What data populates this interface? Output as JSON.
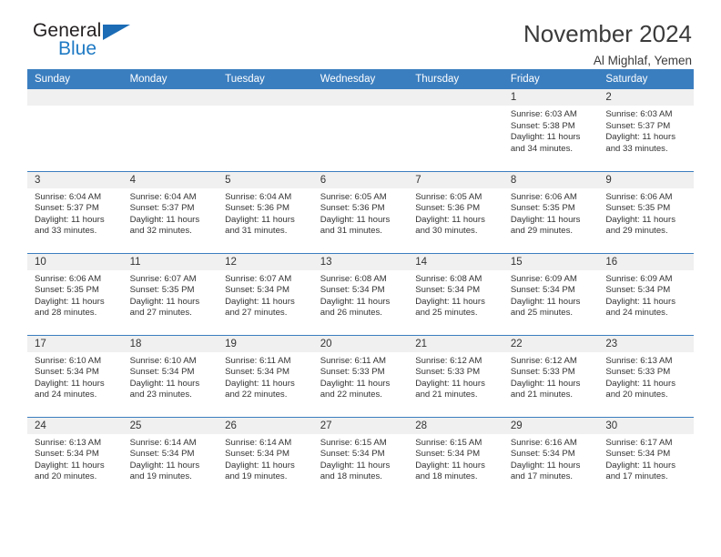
{
  "brand": {
    "word_general": "General",
    "word_blue": "Blue",
    "accent_color": "#1b6cb5"
  },
  "header": {
    "title": "November 2024",
    "subtitle": "Al Mighlaf, Yemen"
  },
  "theme": {
    "header_row_bg": "#3b7ebf",
    "daynum_bg": "#f0f0f0",
    "text_color": "#333333"
  },
  "weekday_headers": [
    "Sunday",
    "Monday",
    "Tuesday",
    "Wednesday",
    "Thursday",
    "Friday",
    "Saturday"
  ],
  "weeks": [
    [
      {
        "day": "",
        "empty": true
      },
      {
        "day": "",
        "empty": true
      },
      {
        "day": "",
        "empty": true
      },
      {
        "day": "",
        "empty": true
      },
      {
        "day": "",
        "empty": true
      },
      {
        "day": "1",
        "sunrise": "Sunrise: 6:03 AM",
        "sunset": "Sunset: 5:38 PM",
        "daylight1": "Daylight: 11 hours",
        "daylight2": "and 34 minutes."
      },
      {
        "day": "2",
        "sunrise": "Sunrise: 6:03 AM",
        "sunset": "Sunset: 5:37 PM",
        "daylight1": "Daylight: 11 hours",
        "daylight2": "and 33 minutes."
      }
    ],
    [
      {
        "day": "3",
        "sunrise": "Sunrise: 6:04 AM",
        "sunset": "Sunset: 5:37 PM",
        "daylight1": "Daylight: 11 hours",
        "daylight2": "and 33 minutes."
      },
      {
        "day": "4",
        "sunrise": "Sunrise: 6:04 AM",
        "sunset": "Sunset: 5:37 PM",
        "daylight1": "Daylight: 11 hours",
        "daylight2": "and 32 minutes."
      },
      {
        "day": "5",
        "sunrise": "Sunrise: 6:04 AM",
        "sunset": "Sunset: 5:36 PM",
        "daylight1": "Daylight: 11 hours",
        "daylight2": "and 31 minutes."
      },
      {
        "day": "6",
        "sunrise": "Sunrise: 6:05 AM",
        "sunset": "Sunset: 5:36 PM",
        "daylight1": "Daylight: 11 hours",
        "daylight2": "and 31 minutes."
      },
      {
        "day": "7",
        "sunrise": "Sunrise: 6:05 AM",
        "sunset": "Sunset: 5:36 PM",
        "daylight1": "Daylight: 11 hours",
        "daylight2": "and 30 minutes."
      },
      {
        "day": "8",
        "sunrise": "Sunrise: 6:06 AM",
        "sunset": "Sunset: 5:35 PM",
        "daylight1": "Daylight: 11 hours",
        "daylight2": "and 29 minutes."
      },
      {
        "day": "9",
        "sunrise": "Sunrise: 6:06 AM",
        "sunset": "Sunset: 5:35 PM",
        "daylight1": "Daylight: 11 hours",
        "daylight2": "and 29 minutes."
      }
    ],
    [
      {
        "day": "10",
        "sunrise": "Sunrise: 6:06 AM",
        "sunset": "Sunset: 5:35 PM",
        "daylight1": "Daylight: 11 hours",
        "daylight2": "and 28 minutes."
      },
      {
        "day": "11",
        "sunrise": "Sunrise: 6:07 AM",
        "sunset": "Sunset: 5:35 PM",
        "daylight1": "Daylight: 11 hours",
        "daylight2": "and 27 minutes."
      },
      {
        "day": "12",
        "sunrise": "Sunrise: 6:07 AM",
        "sunset": "Sunset: 5:34 PM",
        "daylight1": "Daylight: 11 hours",
        "daylight2": "and 27 minutes."
      },
      {
        "day": "13",
        "sunrise": "Sunrise: 6:08 AM",
        "sunset": "Sunset: 5:34 PM",
        "daylight1": "Daylight: 11 hours",
        "daylight2": "and 26 minutes."
      },
      {
        "day": "14",
        "sunrise": "Sunrise: 6:08 AM",
        "sunset": "Sunset: 5:34 PM",
        "daylight1": "Daylight: 11 hours",
        "daylight2": "and 25 minutes."
      },
      {
        "day": "15",
        "sunrise": "Sunrise: 6:09 AM",
        "sunset": "Sunset: 5:34 PM",
        "daylight1": "Daylight: 11 hours",
        "daylight2": "and 25 minutes."
      },
      {
        "day": "16",
        "sunrise": "Sunrise: 6:09 AM",
        "sunset": "Sunset: 5:34 PM",
        "daylight1": "Daylight: 11 hours",
        "daylight2": "and 24 minutes."
      }
    ],
    [
      {
        "day": "17",
        "sunrise": "Sunrise: 6:10 AM",
        "sunset": "Sunset: 5:34 PM",
        "daylight1": "Daylight: 11 hours",
        "daylight2": "and 24 minutes."
      },
      {
        "day": "18",
        "sunrise": "Sunrise: 6:10 AM",
        "sunset": "Sunset: 5:34 PM",
        "daylight1": "Daylight: 11 hours",
        "daylight2": "and 23 minutes."
      },
      {
        "day": "19",
        "sunrise": "Sunrise: 6:11 AM",
        "sunset": "Sunset: 5:34 PM",
        "daylight1": "Daylight: 11 hours",
        "daylight2": "and 22 minutes."
      },
      {
        "day": "20",
        "sunrise": "Sunrise: 6:11 AM",
        "sunset": "Sunset: 5:33 PM",
        "daylight1": "Daylight: 11 hours",
        "daylight2": "and 22 minutes."
      },
      {
        "day": "21",
        "sunrise": "Sunrise: 6:12 AM",
        "sunset": "Sunset: 5:33 PM",
        "daylight1": "Daylight: 11 hours",
        "daylight2": "and 21 minutes."
      },
      {
        "day": "22",
        "sunrise": "Sunrise: 6:12 AM",
        "sunset": "Sunset: 5:33 PM",
        "daylight1": "Daylight: 11 hours",
        "daylight2": "and 21 minutes."
      },
      {
        "day": "23",
        "sunrise": "Sunrise: 6:13 AM",
        "sunset": "Sunset: 5:33 PM",
        "daylight1": "Daylight: 11 hours",
        "daylight2": "and 20 minutes."
      }
    ],
    [
      {
        "day": "24",
        "sunrise": "Sunrise: 6:13 AM",
        "sunset": "Sunset: 5:34 PM",
        "daylight1": "Daylight: 11 hours",
        "daylight2": "and 20 minutes."
      },
      {
        "day": "25",
        "sunrise": "Sunrise: 6:14 AM",
        "sunset": "Sunset: 5:34 PM",
        "daylight1": "Daylight: 11 hours",
        "daylight2": "and 19 minutes."
      },
      {
        "day": "26",
        "sunrise": "Sunrise: 6:14 AM",
        "sunset": "Sunset: 5:34 PM",
        "daylight1": "Daylight: 11 hours",
        "daylight2": "and 19 minutes."
      },
      {
        "day": "27",
        "sunrise": "Sunrise: 6:15 AM",
        "sunset": "Sunset: 5:34 PM",
        "daylight1": "Daylight: 11 hours",
        "daylight2": "and 18 minutes."
      },
      {
        "day": "28",
        "sunrise": "Sunrise: 6:15 AM",
        "sunset": "Sunset: 5:34 PM",
        "daylight1": "Daylight: 11 hours",
        "daylight2": "and 18 minutes."
      },
      {
        "day": "29",
        "sunrise": "Sunrise: 6:16 AM",
        "sunset": "Sunset: 5:34 PM",
        "daylight1": "Daylight: 11 hours",
        "daylight2": "and 17 minutes."
      },
      {
        "day": "30",
        "sunrise": "Sunrise: 6:17 AM",
        "sunset": "Sunset: 5:34 PM",
        "daylight1": "Daylight: 11 hours",
        "daylight2": "and 17 minutes."
      }
    ]
  ]
}
